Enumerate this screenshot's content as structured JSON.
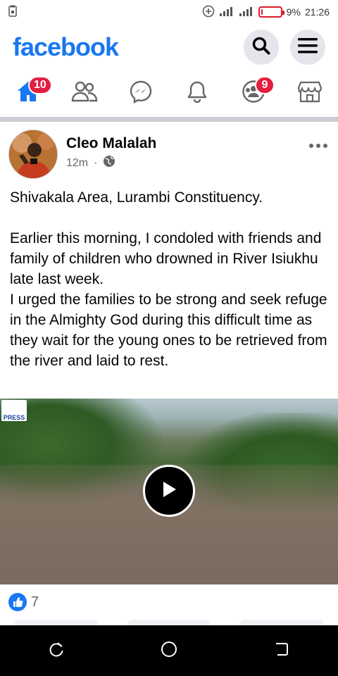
{
  "status_bar": {
    "battery_percent": "9%",
    "battery_level": 0.09,
    "time": "21:26",
    "icons": [
      "sd-card-icon",
      "data-saver-icon",
      "signal-icon",
      "signal-icon",
      "battery-icon"
    ]
  },
  "header": {
    "logo_text": "facebook",
    "brand_color": "#1877f2"
  },
  "nav": {
    "tabs": [
      {
        "name": "home",
        "icon": "home-icon",
        "badge": "10",
        "active": true
      },
      {
        "name": "friends",
        "icon": "friends-icon",
        "badge": ""
      },
      {
        "name": "messenger",
        "icon": "messenger-icon",
        "badge": ""
      },
      {
        "name": "notifications",
        "icon": "bell-icon",
        "badge": ""
      },
      {
        "name": "groups",
        "icon": "groups-icon",
        "badge": "9"
      },
      {
        "name": "marketplace",
        "icon": "marketplace-icon",
        "badge": ""
      }
    ],
    "badge_color": "#e41e3f"
  },
  "post": {
    "author": "Cleo Malalah",
    "time": "12m",
    "separator": "·",
    "privacy_icon": "globe-icon",
    "text": "Shivakala Area, Lurambi Constituency.\n\nEarlier this morning, I condoled with friends and family of children who drowned in River Isiukhu late last week.\nI urged the families to be strong and seek refuge in the Almighty God during this difficult time as they wait for the young ones to be retrieved from the river and laid to rest.",
    "video_watermark": "PRESS",
    "reaction_count": "7"
  }
}
